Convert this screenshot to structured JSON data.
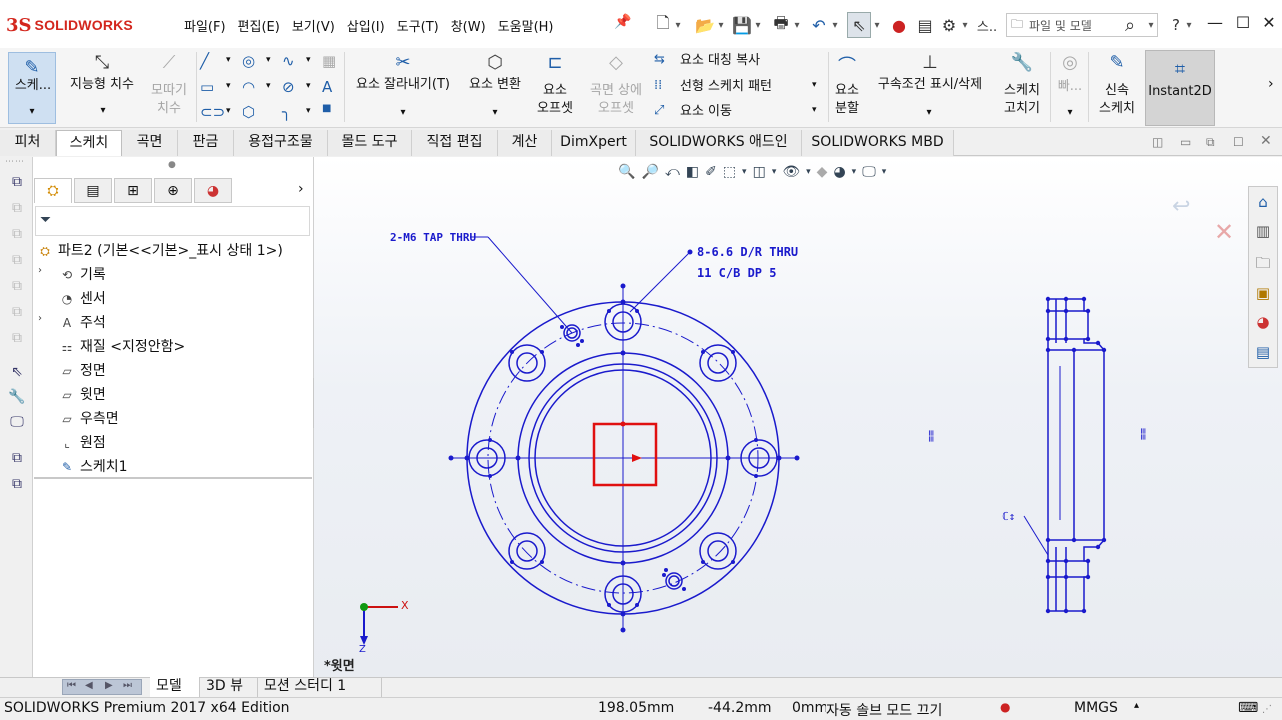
{
  "app": {
    "logo_mark": "3S",
    "logo_text": "SOLIDWORKS"
  },
  "menu": [
    "파일(F)",
    "편집(E)",
    "보기(V)",
    "삽입(I)",
    "도구(T)",
    "창(W)",
    "도움말(H)"
  ],
  "search": {
    "placeholder": "파일 및 모델"
  },
  "quick_access": {
    "more": "스..",
    "help": "?"
  },
  "ribbon": {
    "sketch": "스케...",
    "smart_dim": "지능형 치수",
    "trim_entity_top": "모따기",
    "trim_entity_bottom": "치수",
    "trim": "요소 잘라내기(T)",
    "convert": "요소 변환",
    "offset_top": "요소",
    "offset_bottom": "오프셋",
    "surface_offset_top": "곡면 상에",
    "surface_offset_bottom": "오프셋",
    "mirror": "요소 대칭 복사",
    "linear_pattern": "선형 스케치 패턴",
    "move": "요소 이동",
    "split_top": "요소",
    "split_bottom": "분할",
    "relations": "구속조건 표시/삭제",
    "repair_top": "스케치",
    "repair_bottom": "고치기",
    "quick_snap": "빠...",
    "rapid_top": "신속",
    "rapid_bottom": "스케치",
    "instant2d": "Instant2D"
  },
  "tabs": [
    "피처",
    "스케치",
    "곡면",
    "판금",
    "용접구조물",
    "몰드 도구",
    "직접 편집",
    "계산",
    "DimXpert",
    "SOLIDWORKS 애드인",
    "SOLIDWORKS MBD"
  ],
  "active_tab": "스케치",
  "feature_tree": {
    "root": "파트2  (기본<<기본>_표시 상태 1>)",
    "items": [
      {
        "label": "기록",
        "expandable": true
      },
      {
        "label": "센서",
        "expandable": false
      },
      {
        "label": "주석",
        "expandable": true
      },
      {
        "label": "재질 <지정안함>",
        "expandable": false
      },
      {
        "label": "정면",
        "expandable": false
      },
      {
        "label": "윗면",
        "expandable": false
      },
      {
        "label": "우측면",
        "expandable": false
      },
      {
        "label": "원점",
        "expandable": false
      },
      {
        "label": "스케치1",
        "expandable": false
      }
    ]
  },
  "drawing": {
    "note1": "2-M6 TAP THRU",
    "note2_line1": "8-6.6 D/R THRU",
    "note2_line2": "11 C/B DP 5",
    "view_label": "*윗면",
    "triad_x": "X",
    "triad_z": "Z",
    "colors": {
      "geometry": "#1a1acc",
      "selected": "#e01010"
    }
  },
  "bottom_tabs": [
    "모델",
    "3D 뷰",
    "모션 스터디 1"
  ],
  "active_bottom_tab": "모델",
  "status": {
    "edition": "SOLIDWORKS Premium 2017 x64 Edition",
    "x": "198.05mm",
    "y": "-44.2mm",
    "z": "0mm",
    "mode": "자동 솔브 모드 끄기",
    "units": "MMGS"
  }
}
